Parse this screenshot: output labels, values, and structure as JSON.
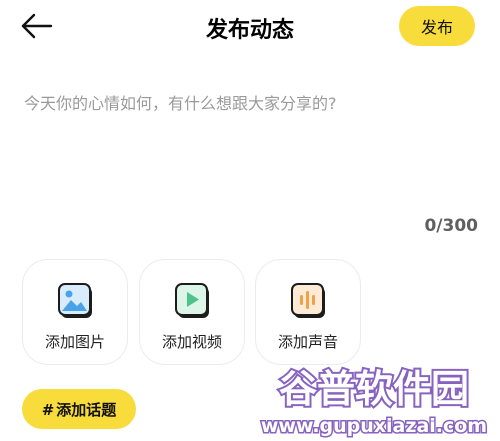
{
  "header": {
    "title": "发布动态",
    "publish_label": "发布"
  },
  "compose": {
    "placeholder": "今天你的心情如何，有什么想跟大家分享的?",
    "value": ""
  },
  "counter": "0/300",
  "media": [
    {
      "label": "添加图片",
      "icon": "image-icon"
    },
    {
      "label": "添加视频",
      "icon": "video-icon"
    },
    {
      "label": "添加声音",
      "icon": "audio-icon"
    }
  ],
  "topic": {
    "hash": "#",
    "label": "添加话题"
  },
  "watermark": {
    "name": "谷普软件园",
    "url": "www.gupuxiazai.com"
  },
  "colors": {
    "accent": "#f7dc3c",
    "icon_blue": "#4aa3e8",
    "icon_green": "#4cc38a",
    "icon_orange": "#f0a14a",
    "watermark_purple": "#6a3db0"
  }
}
